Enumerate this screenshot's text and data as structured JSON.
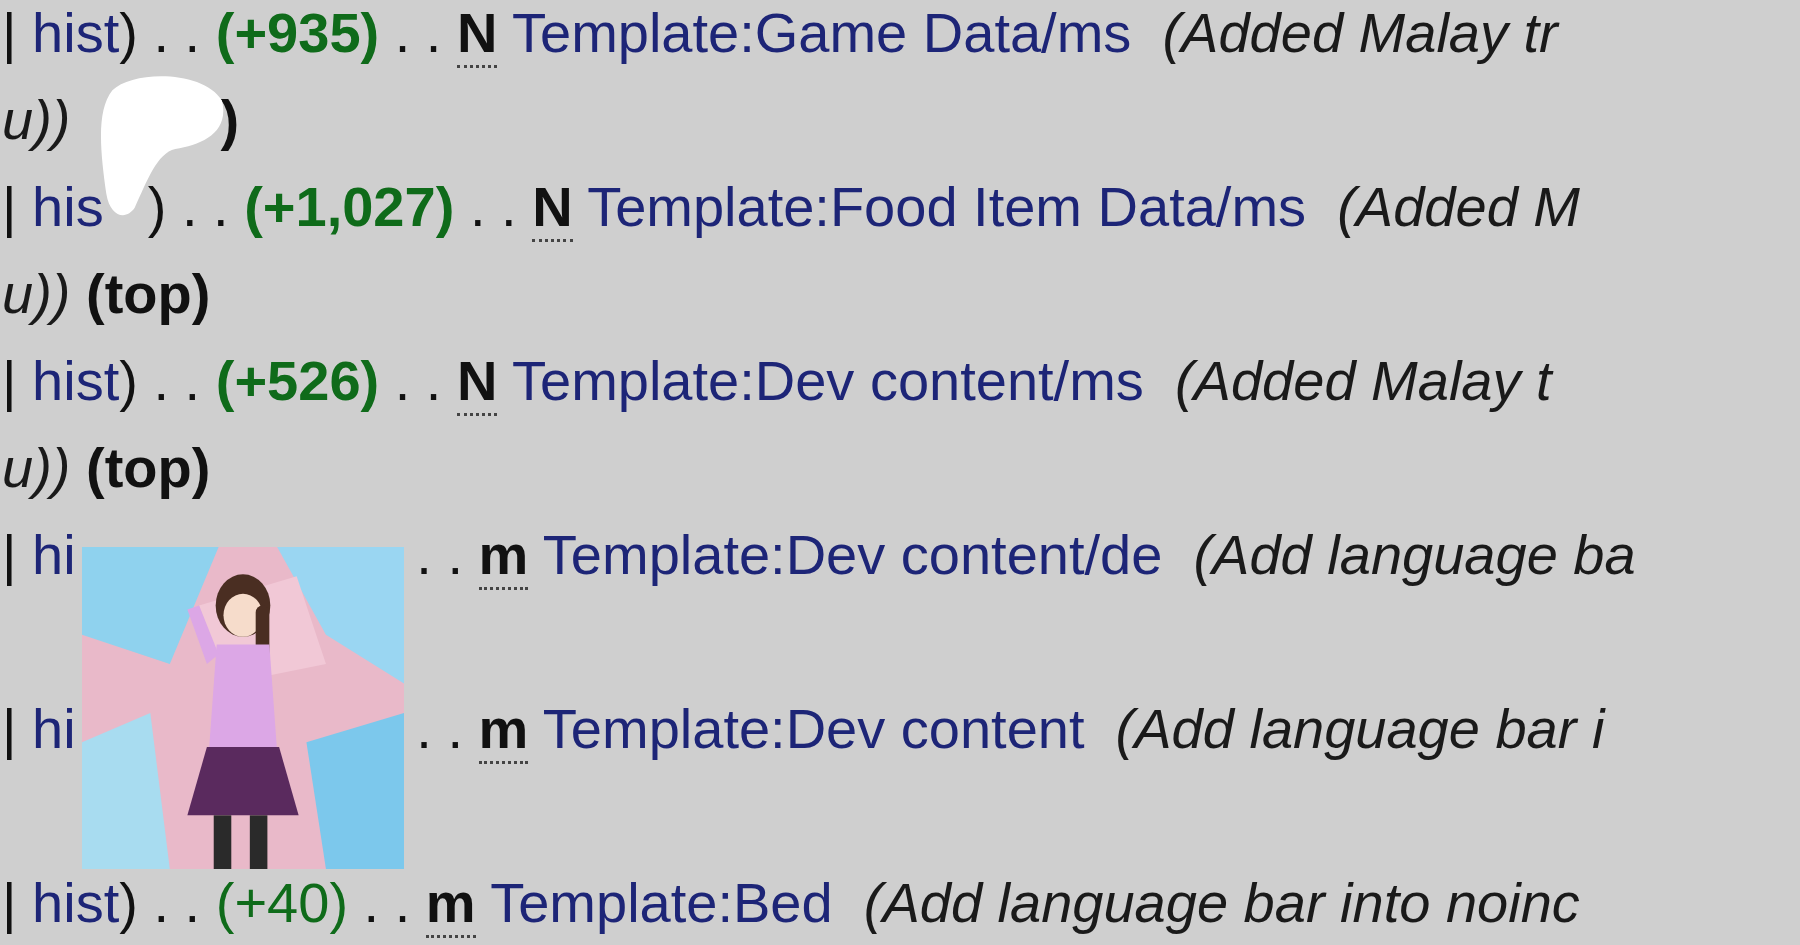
{
  "lines": [
    {
      "kind": "entry",
      "pieces": [
        {
          "kind": "plain",
          "text": "|"
        },
        {
          "kind": "link",
          "text": "hist"
        },
        {
          "kind": "closing",
          "text": ")"
        },
        {
          "kind": "plain",
          "text": ". ."
        },
        {
          "kind": "diff",
          "text": "(+935)",
          "strong": true
        },
        {
          "kind": "plain",
          "text": ". ."
        },
        {
          "kind": "flag",
          "text": "N"
        },
        {
          "kind": "link",
          "text": "Template:Game Data/ms"
        },
        {
          "kind": "summary",
          "text": "(Added Malay tr"
        }
      ]
    },
    {
      "kind": "entry",
      "pieces": [
        {
          "kind": "summary",
          "text": "u))"
        },
        {
          "kind": "gap-blob"
        },
        {
          "kind": "closing-bold",
          "text": ")"
        }
      ]
    },
    {
      "kind": "entry",
      "pieces": [
        {
          "kind": "plain",
          "text": "|"
        },
        {
          "kind": "link",
          "text": "his"
        },
        {
          "kind": "gap-tail"
        },
        {
          "kind": "closing",
          "text": ")"
        },
        {
          "kind": "plain",
          "text": ". ."
        },
        {
          "kind": "diff",
          "text": "(+1,027)",
          "strong": true
        },
        {
          "kind": "plain",
          "text": ". ."
        },
        {
          "kind": "flag",
          "text": "N"
        },
        {
          "kind": "link",
          "text": "Template:Food Item Data/ms"
        },
        {
          "kind": "summary",
          "text": "(Added M"
        }
      ]
    },
    {
      "kind": "entry",
      "pieces": [
        {
          "kind": "summary",
          "text": "u))"
        },
        {
          "kind": "bold",
          "text": "(top)"
        }
      ]
    },
    {
      "kind": "entry",
      "pieces": [
        {
          "kind": "plain",
          "text": "|"
        },
        {
          "kind": "link",
          "text": "hist"
        },
        {
          "kind": "closing",
          "text": ")"
        },
        {
          "kind": "plain",
          "text": ". ."
        },
        {
          "kind": "diff",
          "text": "(+526)",
          "strong": true
        },
        {
          "kind": "plain",
          "text": ". ."
        },
        {
          "kind": "flag",
          "text": "N"
        },
        {
          "kind": "link",
          "text": "Template:Dev content/ms"
        },
        {
          "kind": "summary",
          "text": "(Added Malay t"
        }
      ]
    },
    {
      "kind": "entry",
      "pieces": [
        {
          "kind": "summary",
          "text": "u))"
        },
        {
          "kind": "bold",
          "text": "(top)"
        }
      ]
    },
    {
      "kind": "entry",
      "pieces": [
        {
          "kind": "plain",
          "text": "|"
        },
        {
          "kind": "link",
          "text": "hi"
        },
        {
          "kind": "gap-sticker"
        },
        {
          "kind": "plain",
          "text": ". ."
        },
        {
          "kind": "flag",
          "text": "m"
        },
        {
          "kind": "link",
          "text": "Template:Dev content/de"
        },
        {
          "kind": "summary",
          "text": "(Add language ba"
        }
      ]
    },
    {
      "kind": "blank"
    },
    {
      "kind": "entry",
      "pieces": [
        {
          "kind": "plain",
          "text": "|"
        },
        {
          "kind": "link",
          "text": "hi"
        },
        {
          "kind": "gap-sticker"
        },
        {
          "kind": "plain",
          "text": ". ."
        },
        {
          "kind": "flag",
          "text": "m"
        },
        {
          "kind": "link",
          "text": "Template:Dev content"
        },
        {
          "kind": "summary",
          "text": "(Add language bar i"
        }
      ]
    },
    {
      "kind": "blank"
    },
    {
      "kind": "entry",
      "pieces": [
        {
          "kind": "plain",
          "text": "|"
        },
        {
          "kind": "link",
          "text": "hist"
        },
        {
          "kind": "closing",
          "text": ")"
        },
        {
          "kind": "plain",
          "text": ". ."
        },
        {
          "kind": "diff",
          "text": "(+40)",
          "strong": false
        },
        {
          "kind": "plain",
          "text": ". ."
        },
        {
          "kind": "flag",
          "text": "m"
        },
        {
          "kind": "link",
          "text": "Template:Bed"
        },
        {
          "kind": "summary",
          "text": "(Add language bar into noinc"
        }
      ]
    }
  ]
}
